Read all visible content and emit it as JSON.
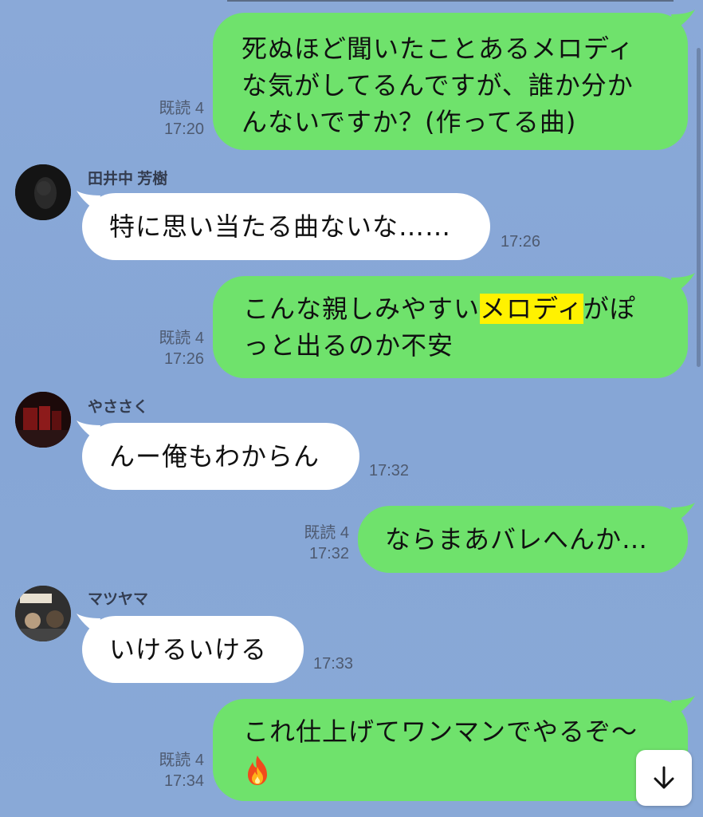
{
  "messages": [
    {
      "id": "m1",
      "side": "out",
      "lines": [
        "死ぬほど聞いたことあるメロディ",
        "な気がしてるんですが、誰か分か",
        "んないですか？(作ってる曲)"
      ],
      "read": "既読 4",
      "time": "17:20"
    },
    {
      "id": "m2",
      "side": "in",
      "sender": "田井中 芳樹",
      "text": "特に思い当たる曲ないな……",
      "time": "17:26"
    },
    {
      "id": "m3",
      "side": "out",
      "line1_before": "こんな親しみやすい",
      "line1_highlight": "メロディ",
      "line1_after": "がぽ",
      "line2": "っと出るのか不安",
      "read": "既読 4",
      "time": "17:26"
    },
    {
      "id": "m4",
      "side": "in",
      "sender": "やささく",
      "text": "んー俺もわからん",
      "time": "17:32"
    },
    {
      "id": "m5",
      "side": "out",
      "text": "ならまあバレへんか…",
      "read": "既読 4",
      "time": "17:32"
    },
    {
      "id": "m6",
      "side": "in",
      "sender": "マツヤマ",
      "text": "いけるいける",
      "time": "17:33"
    },
    {
      "id": "m7",
      "side": "out",
      "line1": "これ仕上げてワンマンでやるぞ〜",
      "emoji": "fire-icon",
      "read": "既読 4",
      "time": "17:34"
    }
  ],
  "colors": {
    "background": "#8aaad8",
    "outgoing_bubble": "#6fe26c",
    "incoming_bubble": "#ffffff",
    "highlight": "#fff200",
    "meta_text": "#4e5a70"
  },
  "scroll_button": {
    "icon": "arrow-down-icon"
  }
}
